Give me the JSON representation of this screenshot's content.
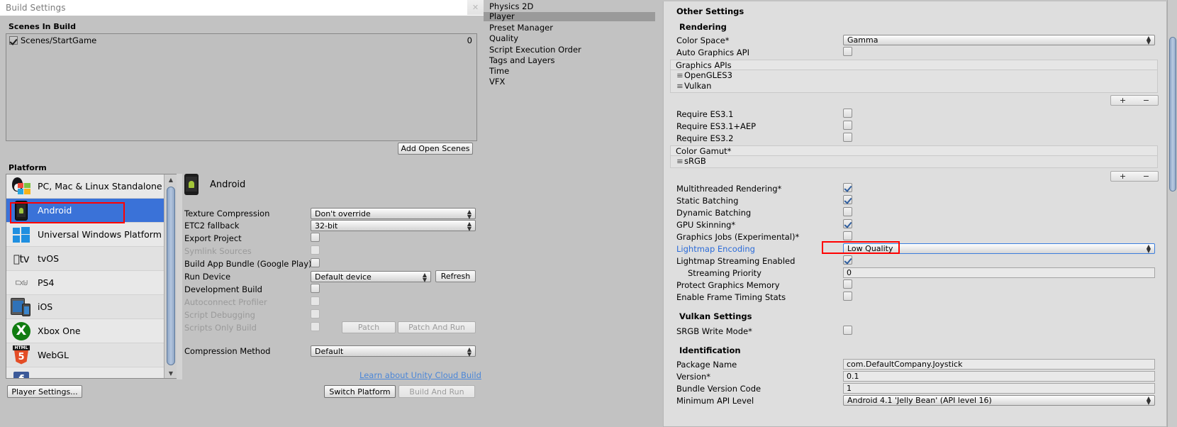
{
  "build_window": {
    "title": "Build Settings",
    "close_icon": "close-icon",
    "scenes_in_build": {
      "header": "Scenes In Build",
      "scenes": [
        {
          "name": "Scenes/StartGame",
          "checked": true,
          "index": "0"
        }
      ],
      "add_open_scenes_label": "Add Open Scenes"
    },
    "platform": {
      "header": "Platform",
      "items": [
        {
          "label": "PC, Mac & Linux Standalone",
          "icon": "standalone-icon",
          "selected": false
        },
        {
          "label": "Android",
          "icon": "android-icon",
          "selected": true
        },
        {
          "label": "Universal Windows Platform",
          "icon": "windows-icon",
          "selected": false
        },
        {
          "label": "tvOS",
          "icon": "apple-tv-icon",
          "selected": false
        },
        {
          "label": "PS4",
          "icon": "playstation-icon",
          "selected": false
        },
        {
          "label": "iOS",
          "icon": "ios-icon",
          "selected": false
        },
        {
          "label": "Xbox One",
          "icon": "xbox-icon",
          "selected": false
        },
        {
          "label": "WebGL",
          "icon": "webgl-icon",
          "selected": false
        },
        {
          "label": "",
          "icon": "facebook-icon",
          "selected": false
        }
      ],
      "player_settings_label": "Player Settings..."
    },
    "android_options": {
      "title": "Android",
      "icon": "android-icon",
      "rows": [
        {
          "label": "Texture Compression",
          "type": "popup",
          "value": "Don't override",
          "disabled": false
        },
        {
          "label": "ETC2 fallback",
          "type": "popup",
          "value": "32-bit",
          "disabled": false
        },
        {
          "label": "Export Project",
          "type": "checkbox",
          "checked": false,
          "disabled": false
        },
        {
          "label": "Symlink Sources",
          "type": "checkbox",
          "checked": false,
          "disabled": true
        },
        {
          "label": "Build App Bundle (Google Play)",
          "type": "checkbox",
          "checked": false,
          "disabled": false
        },
        {
          "label": "Run Device",
          "type": "popup",
          "value": "Default device",
          "disabled": false
        },
        {
          "label": "Development Build",
          "type": "checkbox",
          "checked": false,
          "disabled": false
        },
        {
          "label": "Autoconnect Profiler",
          "type": "checkbox",
          "checked": false,
          "disabled": true
        },
        {
          "label": "Script Debugging",
          "type": "checkbox",
          "checked": false,
          "disabled": true
        },
        {
          "label": "Scripts Only Build",
          "type": "checkbox",
          "checked": false,
          "disabled": true
        },
        {
          "label": "Compression Method",
          "type": "popup",
          "value": "Default",
          "disabled": false
        }
      ],
      "refresh_label": "Refresh",
      "patch_label": "Patch",
      "patch_and_run_label": "Patch And Run",
      "cloud_build_link": "Learn about Unity Cloud Build",
      "switch_platform_label": "Switch Platform",
      "build_and_run_label": "Build And Run"
    }
  },
  "nav": {
    "items": [
      {
        "label": "Physics 2D",
        "selected": false
      },
      {
        "label": "Player",
        "selected": true
      },
      {
        "label": "Preset Manager",
        "selected": false
      },
      {
        "label": "Quality",
        "selected": false
      },
      {
        "label": "Script Execution Order",
        "selected": false
      },
      {
        "label": "Tags and Layers",
        "selected": false
      },
      {
        "label": "Time",
        "selected": false
      },
      {
        "label": "VFX",
        "selected": false
      }
    ]
  },
  "other_settings": {
    "header": "Other Settings",
    "rendering": {
      "header": "Rendering",
      "color_space_label": "Color Space*",
      "color_space_value": "Gamma",
      "auto_graphics_api_label": "Auto Graphics API",
      "auto_graphics_api_checked": false,
      "graphics_apis_header": "Graphics APIs",
      "graphics_apis": [
        "OpenGLES3",
        "Vulkan"
      ],
      "graphics_apis_add": "+",
      "graphics_apis_remove": "−",
      "require_es31_label": "Require ES3.1",
      "require_es31_checked": false,
      "require_es31aep_label": "Require ES3.1+AEP",
      "require_es31aep_checked": false,
      "require_es32_label": "Require ES3.2",
      "require_es32_checked": false,
      "color_gamut_header": "Color Gamut*",
      "color_gamuts": [
        "sRGB"
      ],
      "color_gamut_add": "+",
      "color_gamut_remove": "−",
      "multithreaded_rendering_label": "Multithreaded Rendering*",
      "multithreaded_rendering_checked": true,
      "static_batching_label": "Static Batching",
      "static_batching_checked": true,
      "dynamic_batching_label": "Dynamic Batching",
      "dynamic_batching_checked": false,
      "gpu_skinning_label": "GPU Skinning*",
      "gpu_skinning_checked": true,
      "graphics_jobs_label": "Graphics Jobs (Experimental)*",
      "graphics_jobs_checked": false,
      "lightmap_encoding_label": "Lightmap Encoding",
      "lightmap_encoding_value": "Low Quality",
      "lightmap_streaming_label": "Lightmap Streaming Enabled",
      "lightmap_streaming_checked": true,
      "streaming_priority_label": "Streaming Priority",
      "streaming_priority_value": "0",
      "protect_graphics_memory_label": "Protect Graphics Memory",
      "protect_graphics_memory_checked": false,
      "frame_timing_stats_label": "Enable Frame Timing Stats",
      "frame_timing_stats_checked": false
    },
    "vulkan_settings": {
      "header": "Vulkan Settings",
      "srgb_write_mode_label": "SRGB Write Mode*",
      "srgb_write_mode_checked": false
    },
    "identification": {
      "header": "Identification",
      "package_name_label": "Package Name",
      "package_name_value": "com.DefaultCompany.Joystick",
      "version_label": "Version*",
      "version_value": "0.1",
      "bundle_version_code_label": "Bundle Version Code",
      "bundle_version_code_value": "1",
      "minimum_api_level_label": "Minimum API Level",
      "minimum_api_level_value": "Android 4.1 'Jelly Bean' (API level 16)"
    }
  },
  "annotations": {
    "platform_highlight_color": "#ff0000",
    "lightmap_highlight_color": "#ff0000"
  },
  "colors": {
    "selection_blue": "#3a72d8",
    "link_blue": "#4a86d8",
    "label_blue": "#2b6bd8",
    "panel_gray": "#c2c2c2",
    "inspector_gray": "#dedede"
  }
}
